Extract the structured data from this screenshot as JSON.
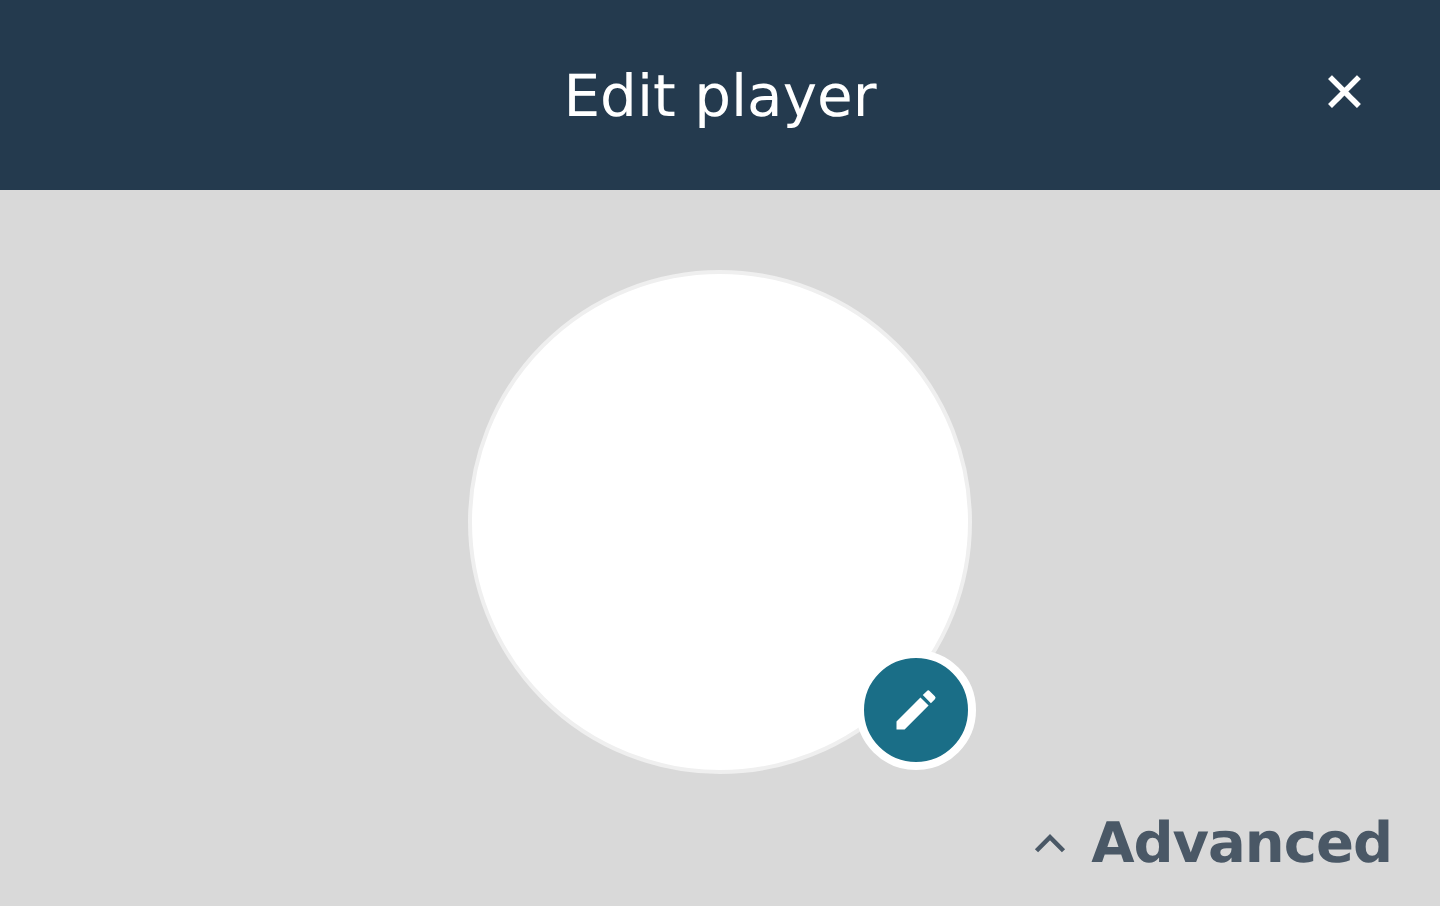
{
  "header": {
    "title": "Edit player",
    "close": "✕"
  },
  "advanced": {
    "label": "Advanced",
    "expanded": true
  }
}
